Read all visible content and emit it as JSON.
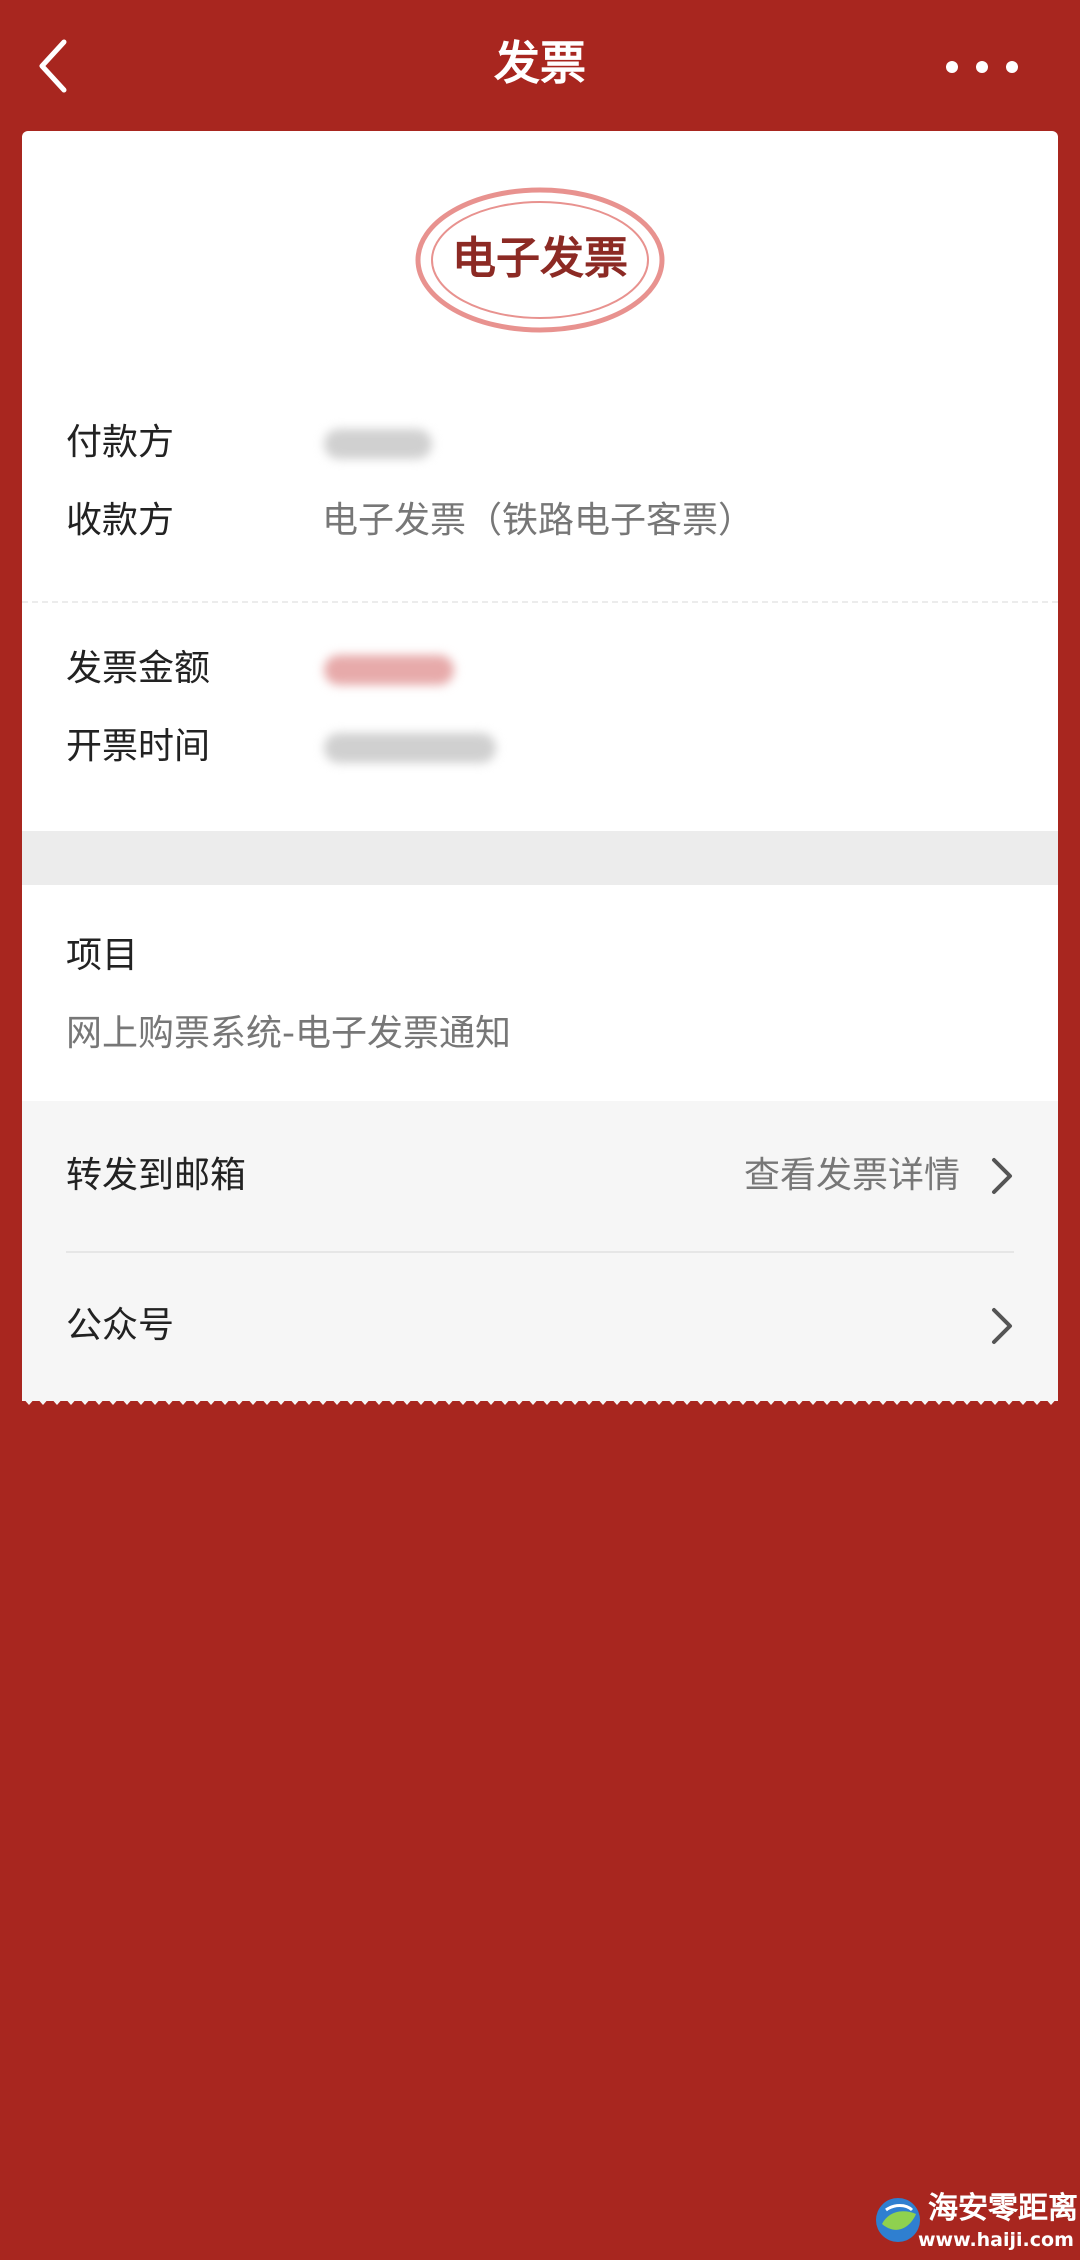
{
  "header": {
    "title": "发票",
    "back_icon": "chevron-left-icon",
    "more_icon": "more-dots-icon"
  },
  "colors": {
    "page_background": "#a8261f",
    "card_background": "#ffffff",
    "stamp_red": "#e8928f",
    "stamp_text": "#8c2a24",
    "action_background": "#f6f6f6"
  },
  "stamp": {
    "text": "电子发票"
  },
  "info": {
    "payer_label": "付款方",
    "payee_label": "收款方",
    "payee_value": "电子发票（铁路电子客票）",
    "amount_label": "发票金额",
    "time_label": "开票时间"
  },
  "item": {
    "label": "项目",
    "value": "网上购票系统-电子发票通知"
  },
  "actions": {
    "forward_label": "转发到邮箱",
    "view_details_label": "查看发票详情",
    "official_account_label": "公众号"
  },
  "watermark": {
    "name": "海安零距离",
    "url": "www.haiji.com"
  }
}
